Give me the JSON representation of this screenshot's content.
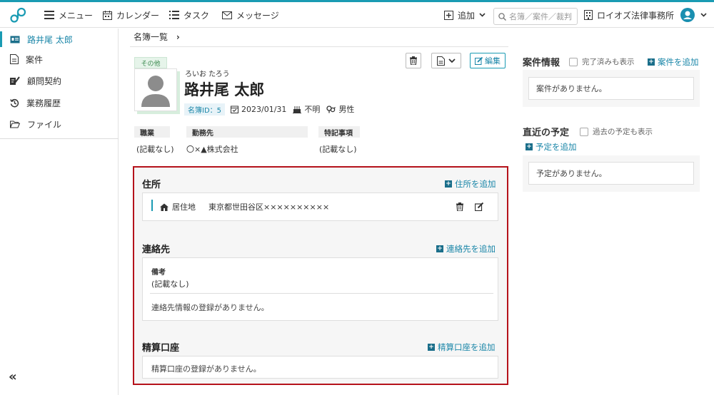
{
  "topbar": {
    "menu_label": "メニュー",
    "calendar_label": "カレンダー",
    "task_label": "タスク",
    "message_label": "メッセージ",
    "add_label": "追加",
    "search_placeholder": "名簿／案件／裁判",
    "office_name": "ロイオズ法律事務所"
  },
  "sidebar": {
    "items": [
      {
        "label": "路井尾 太郎",
        "icon": "contact-card-icon"
      },
      {
        "label": "案件",
        "icon": "document-icon"
      },
      {
        "label": "顧問契約",
        "icon": "contract-sign-icon"
      },
      {
        "label": "業務履歴",
        "icon": "history-icon"
      },
      {
        "label": "ファイル",
        "icon": "folder-open-icon"
      }
    ],
    "collapse_label": "«"
  },
  "breadcrumb": {
    "label": "名簿一覧",
    "sep": "›"
  },
  "profile": {
    "category_tag": "その他",
    "kana": "ろいお たろう",
    "name": "路井尾 太郎",
    "id_label": "名簿ID：5",
    "date": "2023/01/31",
    "birth": "不明",
    "gender": "男性",
    "edit_label": "編集"
  },
  "fields": [
    {
      "label": "職業",
      "value": "(記載なし)"
    },
    {
      "label": "勤務先",
      "value": "〇×▲株式会社"
    },
    {
      "label": "特記事項",
      "value": "(記載なし)"
    }
  ],
  "address": {
    "title": "住所",
    "add_label": "住所を追加",
    "type": "居住地",
    "value": "東京都世田谷区××××××××××"
  },
  "contact": {
    "title": "連絡先",
    "add_label": "連絡先を追加",
    "note_label": "備考",
    "note_value": "(記載なし)",
    "empty": "連絡先情報の登録がありません。"
  },
  "bank": {
    "title": "精算口座",
    "add_label": "精算口座を追加",
    "empty": "精算口座の登録がありません。"
  },
  "cases": {
    "title": "案件情報",
    "check_label": "完了済みも表示",
    "add_label": "案件を追加",
    "empty": "案件がありません。"
  },
  "schedule": {
    "title": "直近の予定",
    "check_label": "過去の予定も表示",
    "add_label": "予定を追加",
    "empty": "予定がありません。"
  },
  "colors": {
    "accent": "#1a9bb3",
    "highlight_border": "#b5121b",
    "link": "#1a86a8"
  }
}
